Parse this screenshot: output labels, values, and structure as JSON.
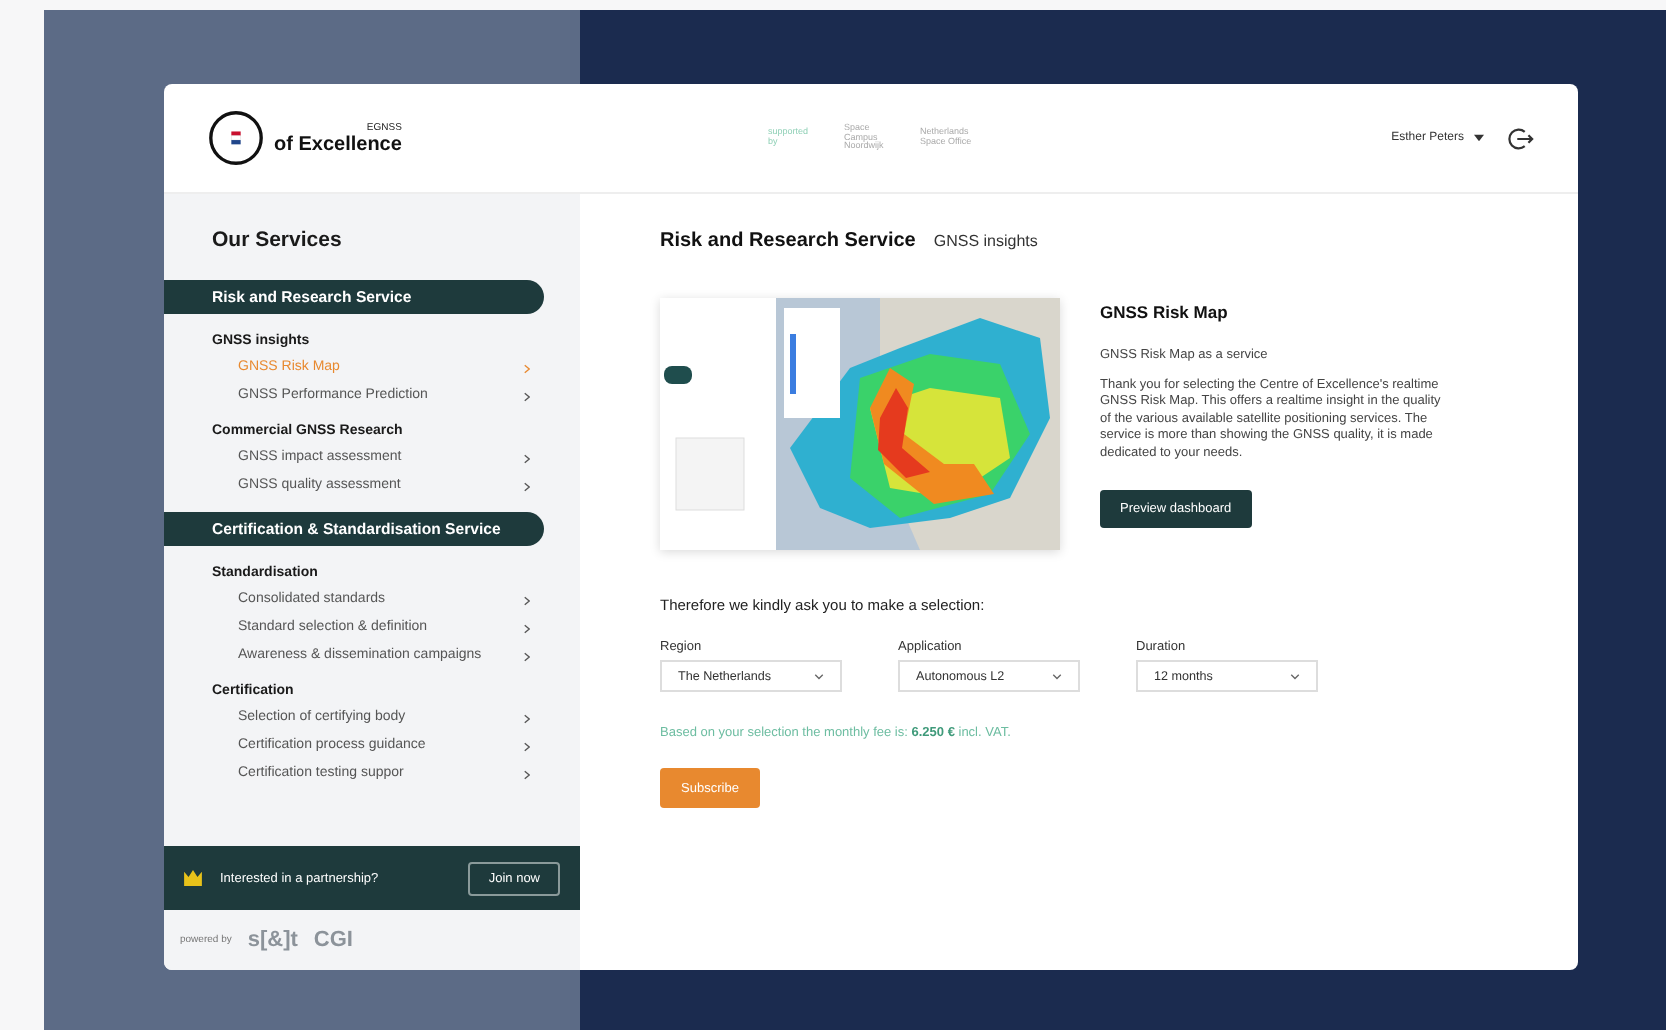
{
  "header": {
    "logo_small": "EGNSS",
    "logo_text": "of Excellence",
    "partners": [
      "supported by",
      "Space Campus Noordwijk",
      "Netherlands Space Office"
    ],
    "user": "Esther Peters"
  },
  "sidebar": {
    "title": "Our Services",
    "sections": [
      {
        "title": "Risk and Research Service",
        "groups": [
          {
            "title": "GNSS insights",
            "items": [
              {
                "label": "GNSS Risk Map",
                "selected": true
              },
              {
                "label": "GNSS Performance Prediction",
                "selected": false
              }
            ]
          },
          {
            "title": "Commercial GNSS Research",
            "items": [
              {
                "label": "GNSS impact assessment",
                "selected": false
              },
              {
                "label": "GNSS quality assessment",
                "selected": false
              }
            ]
          }
        ]
      },
      {
        "title": "Certification & Standardisation Service",
        "groups": [
          {
            "title": "Standardisation",
            "items": [
              {
                "label": "Consolidated standards",
                "selected": false
              },
              {
                "label": "Standard selection & definition",
                "selected": false
              },
              {
                "label": "Awareness & dissemination campaigns",
                "selected": false
              }
            ]
          },
          {
            "title": "Certification",
            "items": [
              {
                "label": "Selection of certifying body",
                "selected": false
              },
              {
                "label": "Certification process guidance",
                "selected": false
              },
              {
                "label": "Certification testing suppor",
                "selected": false
              }
            ]
          }
        ]
      }
    ],
    "partnership": {
      "text": "Interested in a partnership?",
      "button": "Join now"
    },
    "powered": {
      "label": "powered by",
      "brands": [
        "s[&]t",
        "CGI"
      ]
    }
  },
  "main": {
    "title": "Risk and Research Service",
    "subtitle": "GNSS insights",
    "info": {
      "title": "GNSS Risk Map",
      "lead": "GNSS Risk Map as a service",
      "body": "Thank you for selecting the Centre of Excellence's realtime GNSS Risk Map. This offers a realtime insight in the quality of the various available satellite positioning services. The service is more than showing the GNSS quality, it is made dedicated to your needs.",
      "button": "Preview dashboard"
    },
    "prompt": "Therefore we kindly ask you to make a selection:",
    "selects": [
      {
        "label": "Region",
        "value": "The Netherlands"
      },
      {
        "label": "Application",
        "value": "Autonomous L2"
      },
      {
        "label": "Duration",
        "value": "12 months"
      }
    ],
    "fee": "Based on your selection the monthly fee is:  **6.250 €** incl. VAT.",
    "button": "Subscribe"
  }
}
